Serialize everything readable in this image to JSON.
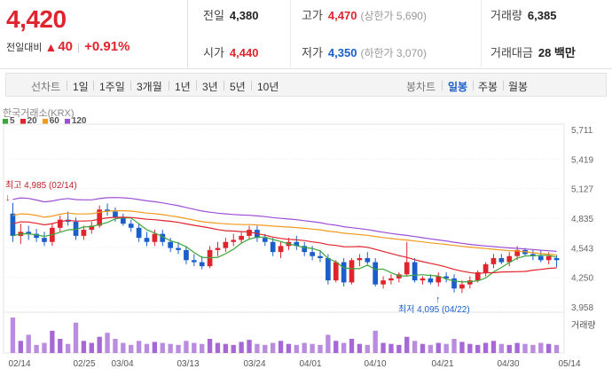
{
  "quote": {
    "price": "4,420",
    "change_label": "전일대비",
    "change_arrow": "▲",
    "change_amount": "40",
    "change_percent": "+0.91%"
  },
  "stats": {
    "prev_close_label": "전일",
    "prev_close": "4,380",
    "high_label": "고가",
    "high": "4,470",
    "upper_limit_label": "(상한가 5,690)",
    "volume_label": "거래량",
    "volume": "6,385",
    "open_label": "시가",
    "open": "4,440",
    "low_label": "저가",
    "low": "4,350",
    "lower_limit_label": "(하한가 3,070)",
    "amount_label": "거래대금",
    "amount": "28 백만"
  },
  "toolbar": {
    "line_chart": "선차트",
    "d1": "1일",
    "w1": "1주일",
    "m3": "3개월",
    "y1": "1년",
    "y3": "3년",
    "y5": "5년",
    "y10": "10년",
    "candle_chart": "봉차트",
    "daily": "일봉",
    "weekly": "주봉",
    "monthly": "월봉"
  },
  "source_label": "한국거래소(KRX)",
  "legend": [
    {
      "label": "5",
      "color": "#3aa63a"
    },
    {
      "label": "20",
      "color": "#e0242d"
    },
    {
      "label": "60",
      "color": "#f39a1e"
    },
    {
      "label": "120",
      "color": "#9b4fd6"
    }
  ],
  "chart_data": {
    "type": "candlestick",
    "y_ticks": [
      "5,711",
      "5,419",
      "5,127",
      "4,835",
      "4,543",
      "4,250",
      "3,958"
    ],
    "y_range": [
      3958,
      5711
    ],
    "x_ticks": [
      "02/14",
      "02/25",
      "03/04",
      "03/13",
      "03/24",
      "04/01",
      "04/10",
      "04/21",
      "04/30",
      "05/14"
    ],
    "high_annotation": "최고 4,985 (02/14)",
    "low_annotation": "최저 4,095 (04/22)",
    "volume_label": "거래량",
    "up_color": "#e0242d",
    "down_color": "#1a5ecb",
    "candles": [
      [
        4880,
        4985,
        4600,
        4660
      ],
      [
        4660,
        4780,
        4580,
        4700
      ],
      [
        4700,
        4760,
        4620,
        4680
      ],
      [
        4680,
        4730,
        4600,
        4640
      ],
      [
        4640,
        4700,
        4560,
        4600
      ],
      [
        4600,
        4780,
        4560,
        4740
      ],
      [
        4740,
        4860,
        4700,
        4820
      ],
      [
        4820,
        4900,
        4760,
        4800
      ],
      [
        4800,
        4840,
        4620,
        4660
      ],
      [
        4660,
        4760,
        4620,
        4720
      ],
      [
        4720,
        4800,
        4680,
        4760
      ],
      [
        4760,
        4960,
        4740,
        4920
      ],
      [
        4920,
        4980,
        4860,
        4900
      ],
      [
        4900,
        4940,
        4800,
        4840
      ],
      [
        4840,
        4880,
        4760,
        4780
      ],
      [
        4780,
        4820,
        4700,
        4740
      ],
      [
        4740,
        4780,
        4600,
        4640
      ],
      [
        4640,
        4700,
        4560,
        4600
      ],
      [
        4600,
        4720,
        4560,
        4680
      ],
      [
        4680,
        4720,
        4560,
        4600
      ],
      [
        4600,
        4640,
        4500,
        4540
      ],
      [
        4540,
        4600,
        4480,
        4520
      ],
      [
        4520,
        4560,
        4380,
        4420
      ],
      [
        4420,
        4480,
        4360,
        4400
      ],
      [
        4400,
        4460,
        4330,
        4360
      ],
      [
        4360,
        4560,
        4340,
        4520
      ],
      [
        4520,
        4600,
        4460,
        4540
      ],
      [
        4540,
        4640,
        4500,
        4600
      ],
      [
        4600,
        4680,
        4560,
        4620
      ],
      [
        4620,
        4700,
        4580,
        4660
      ],
      [
        4660,
        4760,
        4620,
        4720
      ],
      [
        4720,
        4760,
        4600,
        4640
      ],
      [
        4640,
        4680,
        4560,
        4600
      ],
      [
        4600,
        4640,
        4460,
        4500
      ],
      [
        4500,
        4600,
        4440,
        4560
      ],
      [
        4560,
        4640,
        4520,
        4600
      ],
      [
        4600,
        4660,
        4520,
        4560
      ],
      [
        4560,
        4600,
        4460,
        4500
      ],
      [
        4500,
        4560,
        4420,
        4460
      ],
      [
        4460,
        4520,
        4400,
        4440
      ],
      [
        4440,
        4480,
        4180,
        4220
      ],
      [
        4220,
        4420,
        4200,
        4400
      ],
      [
        4400,
        4440,
        4160,
        4200
      ],
      [
        4200,
        4440,
        4180,
        4420
      ],
      [
        4420,
        4480,
        4360,
        4440
      ],
      [
        4440,
        4500,
        4380,
        4400
      ],
      [
        4400,
        4440,
        4160,
        4180
      ],
      [
        4180,
        4260,
        4140,
        4220
      ],
      [
        4220,
        4280,
        4180,
        4240
      ],
      [
        4240,
        4300,
        4200,
        4280
      ],
      [
        4280,
        4600,
        4260,
        4400
      ],
      [
        4400,
        4440,
        4200,
        4220
      ],
      [
        4220,
        4260,
        4180,
        4240
      ],
      [
        4240,
        4280,
        4180,
        4200
      ],
      [
        4200,
        4300,
        4160,
        4260
      ],
      [
        4260,
        4300,
        4200,
        4240
      ],
      [
        4240,
        4280,
        4100,
        4140
      ],
      [
        4140,
        4220,
        4095,
        4180
      ],
      [
        4180,
        4260,
        4140,
        4220
      ],
      [
        4220,
        4320,
        4200,
        4300
      ],
      [
        4300,
        4400,
        4260,
        4380
      ],
      [
        4380,
        4480,
        4340,
        4440
      ],
      [
        4440,
        4480,
        4380,
        4400
      ],
      [
        4400,
        4500,
        4360,
        4460
      ],
      [
        4460,
        4560,
        4420,
        4520
      ],
      [
        4520,
        4540,
        4460,
        4480
      ],
      [
        4480,
        4520,
        4420,
        4460
      ],
      [
        4460,
        4520,
        4400,
        4420
      ],
      [
        4420,
        4500,
        4380,
        4460
      ],
      [
        4440,
        4470,
        4350,
        4420
      ]
    ],
    "volumes": [
      35,
      12,
      18,
      8,
      10,
      22,
      14,
      9,
      30,
      12,
      10,
      16,
      20,
      14,
      10,
      8,
      12,
      9,
      11,
      10,
      9,
      8,
      12,
      10,
      9,
      14,
      10,
      9,
      8,
      11,
      13,
      9,
      8,
      10,
      12,
      9,
      8,
      10,
      9,
      8,
      18,
      12,
      10,
      14,
      9,
      8,
      22,
      10,
      9,
      8,
      16,
      12,
      9,
      8,
      10,
      9,
      14,
      11,
      9,
      8,
      10,
      12,
      9,
      8,
      10,
      9,
      8,
      10,
      9,
      8
    ]
  }
}
